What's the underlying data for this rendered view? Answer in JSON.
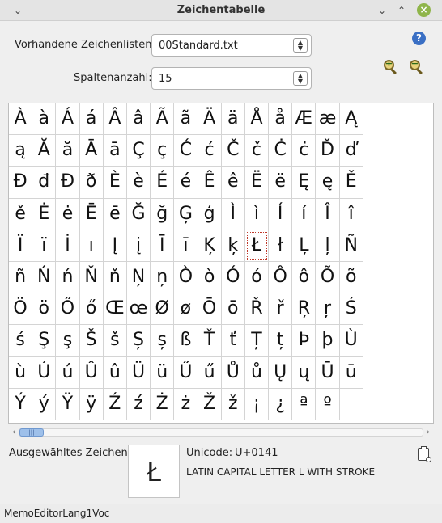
{
  "window": {
    "title": "Zeichentabelle",
    "menu_glyph": "⌄",
    "minimize_glyph": "⌄",
    "maximize_glyph": "⌃",
    "close_glyph": "×"
  },
  "lists": {
    "label": "Vorhandene Zeichenlisten:",
    "value": "00Standard.txt"
  },
  "columns": {
    "label": "Spaltenanzahl:",
    "value": "15"
  },
  "help_glyph": "?",
  "zoom": {
    "in_glyph": "+",
    "out_glyph": "−"
  },
  "grid": {
    "column_count": 15,
    "selected_index": 70,
    "chars": [
      "À",
      "à",
      "Á",
      "á",
      "Â",
      "â",
      "Ã",
      "ã",
      "Ä",
      "ä",
      "Å",
      "å",
      "Æ",
      "æ",
      "Ą",
      "ą",
      "Ă",
      "ă",
      "Ā",
      "ā",
      "Ç",
      "ç",
      "Ć",
      "ć",
      "Č",
      "č",
      "Ċ",
      "ċ",
      "Ď",
      "ď",
      "Đ",
      "đ",
      "Ð",
      "ð",
      "È",
      "è",
      "É",
      "é",
      "Ê",
      "ê",
      "Ë",
      "ë",
      "Ę",
      "ę",
      "Ě",
      "ě",
      "Ė",
      "ė",
      "Ē",
      "ē",
      "Ğ",
      "ğ",
      "Ģ",
      "ģ",
      "Ì",
      "ì",
      "Í",
      "í",
      "Î",
      "î",
      "Ï",
      "ï",
      "İ",
      "ı",
      "Į",
      "į",
      "Ī",
      "ī",
      "Ķ",
      "ķ",
      "Ł",
      "ł",
      "Ļ",
      "ļ",
      "Ñ",
      "ñ",
      "Ń",
      "ń",
      "Ň",
      "ň",
      "Ņ",
      "ņ",
      "Ò",
      "ò",
      "Ó",
      "ó",
      "Ô",
      "ô",
      "Õ",
      "õ",
      "Ö",
      "ö",
      "Ő",
      "ő",
      "Œ",
      "œ",
      "Ø",
      "ø",
      "Ō",
      "ō",
      "Ř",
      "ř",
      "Ŗ",
      "ŗ",
      "Ś",
      "ś",
      "Ş",
      "ş",
      "Š",
      "š",
      "Ș",
      "ș",
      "ß",
      "Ť",
      "ť",
      "Ț",
      "ț",
      "Þ",
      "þ",
      "Ù",
      "ù",
      "Ú",
      "ú",
      "Û",
      "û",
      "Ü",
      "ü",
      "Ű",
      "ű",
      "Ů",
      "ů",
      "Ų",
      "ų",
      "Ū",
      "ū",
      "Ý",
      "ý",
      "Ÿ",
      "ÿ",
      "Ź",
      "ź",
      "Ż",
      "ż",
      "Ž",
      "ž",
      "¡",
      "¿",
      "ª",
      "º",
      ""
    ]
  },
  "scrollbar": {
    "left_arrow": "‹",
    "right_arrow": "›",
    "thumb_grip": "|||"
  },
  "selection": {
    "label": "Ausgewähltes Zeichen:",
    "char": "Ł",
    "unicode_label": "Unicode:",
    "unicode_value": "U+0141",
    "name": "LATIN CAPITAL LETTER L WITH STROKE"
  },
  "status": {
    "text": "MemoEditorLang1Voc"
  }
}
